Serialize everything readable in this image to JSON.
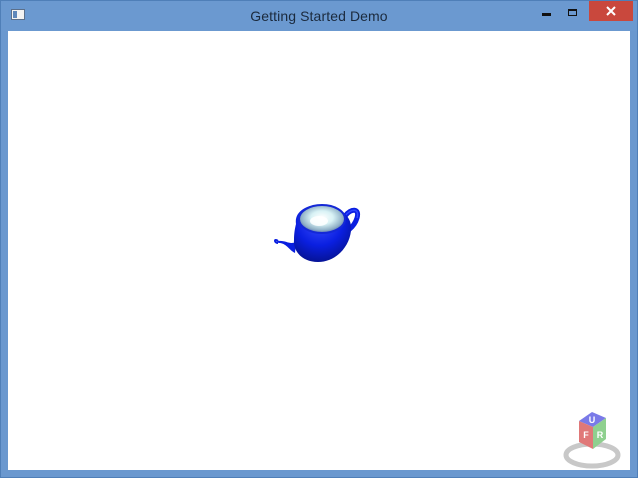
{
  "window": {
    "title": "Getting Started Demo",
    "controls": {
      "minimize_icon": "minimize-icon",
      "maximize_icon": "maximize-icon",
      "close_icon": "close-icon"
    }
  },
  "viewport": {
    "model": "teapot",
    "model_color": "#0a1fe0",
    "background": "#ffffff"
  },
  "view_cube": {
    "faces": [
      "U",
      "R",
      "F"
    ],
    "face_colors": {
      "U": "#7a7ae8",
      "R": "#8fd08f",
      "F": "#e07878"
    }
  }
}
